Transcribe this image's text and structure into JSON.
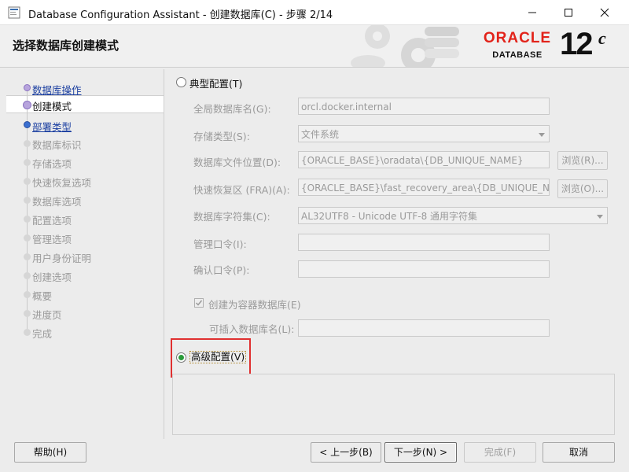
{
  "window": {
    "title": "Database Configuration Assistant - 创建数据库(C) - 步骤 2/14"
  },
  "header": {
    "title": "选择数据库创建模式",
    "logo_brand": "ORACLE",
    "logo_sub": "DATABASE",
    "logo_version": "12",
    "logo_version_suffix": "c"
  },
  "steps": [
    {
      "label": "数据库操作",
      "state": "done"
    },
    {
      "label": "创建模式",
      "state": "current"
    },
    {
      "label": "部署类型",
      "state": "done"
    },
    {
      "label": "数据库标识",
      "state": "future"
    },
    {
      "label": "存储选项",
      "state": "future"
    },
    {
      "label": "快速恢复选项",
      "state": "future"
    },
    {
      "label": "数据库选项",
      "state": "future"
    },
    {
      "label": "配置选项",
      "state": "future"
    },
    {
      "label": "管理选项",
      "state": "future"
    },
    {
      "label": "用户身份证明",
      "state": "future"
    },
    {
      "label": "创建选项",
      "state": "future"
    },
    {
      "label": "概要",
      "state": "future"
    },
    {
      "label": "进度页",
      "state": "future"
    },
    {
      "label": "完成",
      "state": "future"
    }
  ],
  "typical": {
    "radio_label": "典型配置(T)",
    "selected": false,
    "global_db_name_label": "全局数据库名(G):",
    "global_db_name_value": "orcl.docker.internal",
    "storage_type_label": "存储类型(S):",
    "storage_type_value": "文件系统",
    "db_file_location_label": "数据库文件位置(D):",
    "db_file_location_value": "{ORACLE_BASE}\\oradata\\{DB_UNIQUE_NAME}",
    "browse_r_label": "浏览(R)...",
    "fra_label": "快速恢复区 (FRA)(A):",
    "fra_value": "{ORACLE_BASE}\\fast_recovery_area\\{DB_UNIQUE_NAME}",
    "browse_o_label": "浏览(O)...",
    "charset_label": "数据库字符集(C):",
    "charset_value": "AL32UTF8 - Unicode UTF-8 通用字符集",
    "admin_pwd_label": "管理口令(I):",
    "confirm_pwd_label": "确认口令(P):",
    "cdb_label": "创建为容器数据库(E)",
    "cdb_checked": true,
    "pdb_name_label": "可插入数据库名(L):"
  },
  "advanced": {
    "radio_label": "高级配置(V)",
    "selected": true
  },
  "buttons": {
    "help": "帮助(H)",
    "back": "< 上一步(B)",
    "next": "下一步(N) >",
    "finish": "完成(F)",
    "cancel": "取消"
  },
  "colors": {
    "selected_radio": "#2a9b3a",
    "highlight_border": "#e03030",
    "oracle_red": "#e2231a",
    "link": "#1a3ea0"
  }
}
